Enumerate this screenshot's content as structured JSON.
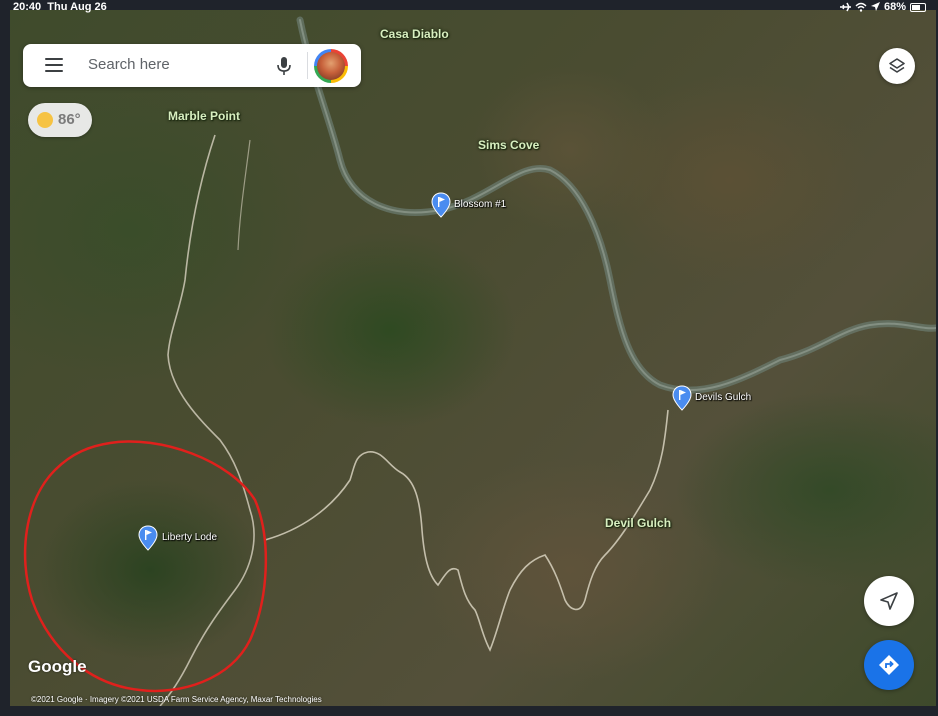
{
  "status_bar": {
    "time": "20:40",
    "date": "Thu Aug 26",
    "battery": "68%",
    "battery_level": 0.68,
    "icons": [
      "airplane-icon",
      "wifi-icon",
      "location-arrow-icon",
      "battery-icon"
    ]
  },
  "search": {
    "placeholder": "Search here",
    "icons": [
      "menu-icon",
      "mic-icon",
      "avatar"
    ]
  },
  "weather": {
    "temperature": "86°",
    "icon": "sun-icon"
  },
  "map_labels": {
    "casa_diablo": "Casa Diablo",
    "marble_point": "Marble Point",
    "sims_cove": "Sims Cove",
    "devil_gulch": "Devil Gulch"
  },
  "pins": {
    "blossom": "Blossom #1",
    "devils_gulch": "Devils Gulch",
    "liberty_lode": "Liberty Lode"
  },
  "controls": {
    "layers": "layers-icon",
    "locate": "navigation-arrow-icon",
    "directions": "directions-icon"
  },
  "branding": {
    "logo": "Google",
    "copyright": "©2021 Google · Imagery ©2021 USDA Farm Service Agency, Maxar Technologies"
  },
  "colors": {
    "annotation_circle": "#e0201c",
    "pin_blue": "#4a8cf0",
    "directions_blue": "#1a73e8",
    "label_green": "#d8efc0"
  }
}
